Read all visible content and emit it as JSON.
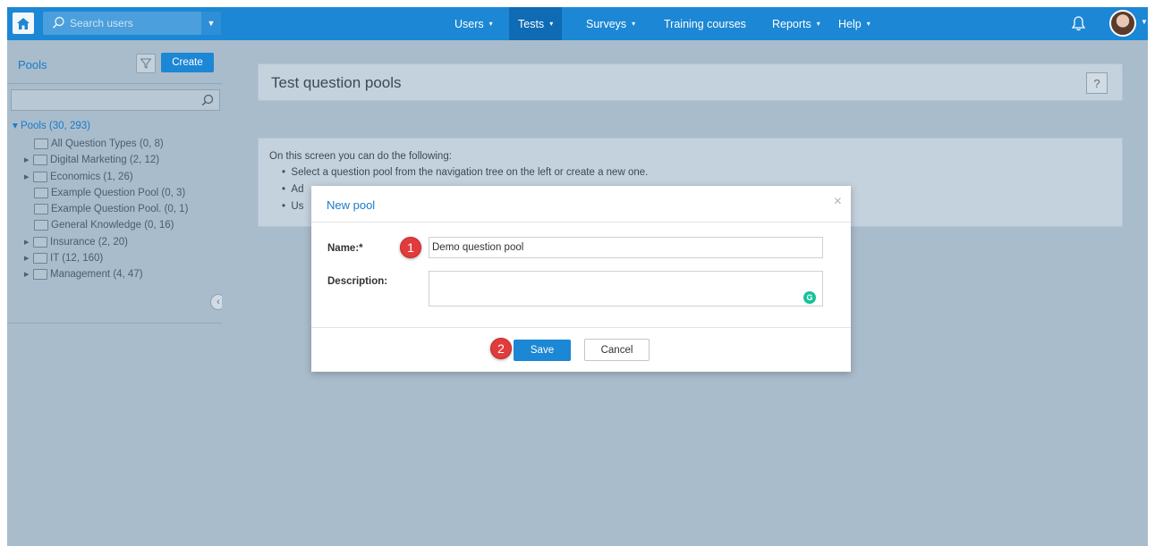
{
  "topbar": {
    "search_placeholder": "Search users",
    "nav": [
      {
        "label": "Users",
        "caret": "▾"
      },
      {
        "label": "Tests",
        "caret": "▾"
      },
      {
        "label": "Surveys",
        "caret": "▾"
      },
      {
        "label": "Training courses",
        "caret": ""
      },
      {
        "label": "Reports",
        "caret": "▾"
      },
      {
        "label": "Help",
        "caret": "▾"
      }
    ],
    "active_nav": "Tests"
  },
  "sidebar": {
    "title": "Pools",
    "create_label": "Create",
    "tree_root": "▾ Pools (30, 293)",
    "tree_items": [
      {
        "label": "All Question Types (0, 8)",
        "expandable": false
      },
      {
        "label": "Digital Marketing (2, 12)",
        "expandable": true
      },
      {
        "label": "Economics (1, 26)",
        "expandable": true
      },
      {
        "label": "Example Question Pool (0, 3)",
        "expandable": false
      },
      {
        "label": "Example Question Pool. (0, 1)",
        "expandable": false
      },
      {
        "label": "General Knowledge (0, 16)",
        "expandable": false
      },
      {
        "label": "Insurance (2, 20)",
        "expandable": true
      },
      {
        "label": "IT (12, 160)",
        "expandable": true
      },
      {
        "label": "Management (4, 47)",
        "expandable": true
      }
    ]
  },
  "main": {
    "page_title": "Test question pools",
    "help_label": "?",
    "info_intro": "On this screen you can do the following:",
    "info_bullets": [
      "Select a question pool from the navigation tree on the left or create a new one.",
      "Ad",
      "Us"
    ]
  },
  "modal": {
    "title": "New pool",
    "close": "×",
    "name_label": "Name:*",
    "name_value": "Demo question pool",
    "description_label": "Description:",
    "save_label": "Save",
    "cancel_label": "Cancel",
    "step_1": "1",
    "step_2": "2"
  },
  "colors": {
    "accent": "#1c87d4",
    "backdrop": "#a9bccc",
    "step_badge": "#e23b3b",
    "grammarly": "#15c39a"
  },
  "icons": [
    "home-icon",
    "search-icon",
    "filter-icon",
    "bell-icon",
    "close-icon",
    "collapse-left-icon",
    "folder-icon",
    "grammarly-icon"
  ]
}
